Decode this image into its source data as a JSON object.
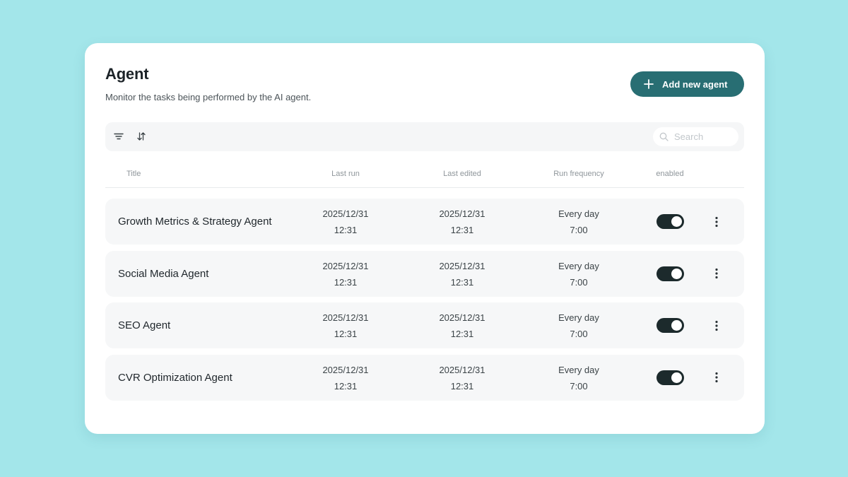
{
  "header": {
    "title": "Agent",
    "subtitle": "Monitor the tasks being performed by the AI agent.",
    "add_button_label": "Add new agent"
  },
  "toolbar": {
    "filter_icon": "filter-icon",
    "sort_icon": "sort-icon",
    "search_placeholder": "Search"
  },
  "table": {
    "columns": [
      "Title",
      "Last run",
      "Last edited",
      "Run frequency",
      "enabled"
    ],
    "rows": [
      {
        "title": "Growth Metrics & Strategy Agent",
        "last_run_date": "2025/12/31",
        "last_run_time": "12:31",
        "last_edited_date": "2025/12/31",
        "last_edited_time": "12:31",
        "frequency": "Every day",
        "frequency_time": "7:00",
        "enabled": true
      },
      {
        "title": "Social Media Agent",
        "last_run_date": "2025/12/31",
        "last_run_time": "12:31",
        "last_edited_date": "2025/12/31",
        "last_edited_time": "12:31",
        "frequency": "Every day",
        "frequency_time": "7:00",
        "enabled": true
      },
      {
        "title": "SEO Agent",
        "last_run_date": "2025/12/31",
        "last_run_time": "12:31",
        "last_edited_date": "2025/12/31",
        "last_edited_time": "12:31",
        "frequency": "Every day",
        "frequency_time": "7:00",
        "enabled": true
      },
      {
        "title": "CVR Optimization Agent",
        "last_run_date": "2025/12/31",
        "last_run_time": "12:31",
        "last_edited_date": "2025/12/31",
        "last_edited_time": "12:31",
        "frequency": "Every day",
        "frequency_time": "7:00",
        "enabled": true
      }
    ]
  },
  "colors": {
    "background": "#a3e6ea",
    "accent": "#286e73",
    "toggle_on": "#1c2a2c"
  }
}
